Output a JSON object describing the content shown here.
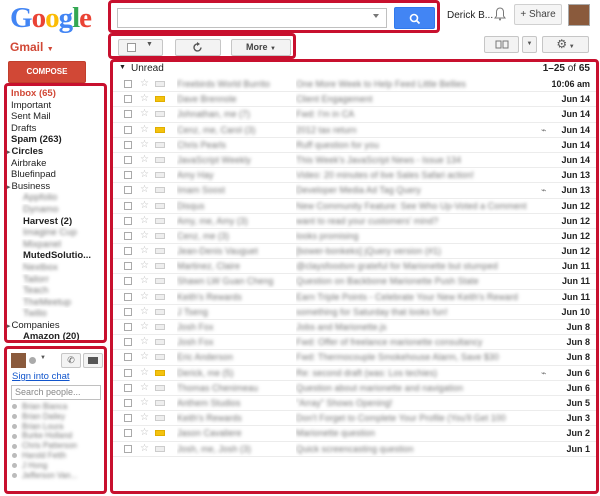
{
  "header": {
    "logo_letters": [
      {
        "ch": "G",
        "color": "#4285f4"
      },
      {
        "ch": "o",
        "color": "#ea4335"
      },
      {
        "ch": "o",
        "color": "#fbbc05"
      },
      {
        "ch": "g",
        "color": "#4285f4"
      },
      {
        "ch": "l",
        "color": "#34a853"
      },
      {
        "ch": "e",
        "color": "#ea4335"
      }
    ],
    "user_name": "Derick B...",
    "share_label": "Share",
    "share_plus": "+"
  },
  "app": {
    "title": "Gmail"
  },
  "toolbar": {
    "more_label": "More"
  },
  "compose_label": "COMPOSE",
  "sidebar": {
    "items": [
      {
        "label": "Inbox (65)",
        "bold": true,
        "red": true,
        "blur": false,
        "indent": 0
      },
      {
        "label": "Important",
        "bold": false,
        "red": false,
        "blur": false,
        "indent": 0
      },
      {
        "label": "Sent Mail",
        "bold": false,
        "red": false,
        "blur": false,
        "indent": 0
      },
      {
        "label": "Drafts",
        "bold": false,
        "red": false,
        "blur": false,
        "indent": 0
      },
      {
        "label": "Spam (263)",
        "bold": true,
        "red": false,
        "blur": false,
        "indent": 0
      },
      {
        "label": "Circles",
        "bold": true,
        "red": false,
        "blur": false,
        "indent": 0,
        "arrow": true
      },
      {
        "label": "Airbrake",
        "bold": false,
        "red": false,
        "blur": false,
        "indent": 0
      },
      {
        "label": "Bluefinpad",
        "bold": false,
        "red": false,
        "blur": false,
        "indent": 0
      },
      {
        "label": "Business",
        "bold": false,
        "red": false,
        "blur": false,
        "indent": 0,
        "arrow": true
      },
      {
        "label": "Appfolio",
        "bold": false,
        "red": false,
        "blur": true,
        "indent": 12
      },
      {
        "label": "Dynamo",
        "bold": false,
        "red": false,
        "blur": true,
        "indent": 12
      },
      {
        "label": "Harvest (2)",
        "bold": true,
        "red": false,
        "blur": false,
        "indent": 12
      },
      {
        "label": "Imagine Cup",
        "bold": false,
        "red": false,
        "blur": true,
        "indent": 12
      },
      {
        "label": "Mixpanel",
        "bold": false,
        "red": false,
        "blur": true,
        "indent": 12
      },
      {
        "label": "MutedSolutio...",
        "bold": true,
        "red": false,
        "blur": false,
        "indent": 12
      },
      {
        "label": "Nextbox",
        "bold": false,
        "red": false,
        "blur": true,
        "indent": 12
      },
      {
        "label": "Tailorr",
        "bold": false,
        "red": false,
        "blur": true,
        "indent": 12
      },
      {
        "label": "Teach",
        "bold": false,
        "red": false,
        "blur": true,
        "indent": 12
      },
      {
        "label": "TheMeetup",
        "bold": false,
        "red": false,
        "blur": true,
        "indent": 12
      },
      {
        "label": "Twilio",
        "bold": false,
        "red": false,
        "blur": true,
        "indent": 12
      },
      {
        "label": "Companies",
        "bold": false,
        "red": false,
        "blur": false,
        "indent": 0,
        "arrow": true
      },
      {
        "label": "Amazon (20)",
        "bold": true,
        "red": false,
        "blur": false,
        "indent": 12
      }
    ]
  },
  "chat": {
    "sign_in_label": "Sign into chat",
    "search_placeholder": "Search people...",
    "contacts": [
      "Brian Bianca",
      "Brian Dailey",
      "Brian Loura",
      "Burke Holland",
      "Chris Patterson",
      "Harold Fetth",
      "J Hong",
      "Jefferson Van..."
    ]
  },
  "mail": {
    "section_label": "Unread",
    "range": "1–25",
    "of_label": "of",
    "total": "65",
    "rows": [
      {
        "sender": "Freebirds World Burrito",
        "subject": "One More Week to Help Feed Little Bellies",
        "date": "10:06 am",
        "flag": "none",
        "clip": false
      },
      {
        "sender": "Dave Brennole",
        "subject": "Client Engagement",
        "date": "Jun 14",
        "flag": "yellow",
        "clip": false
      },
      {
        "sender": "Johnathan, me (7)",
        "subject": "Fwd: I'm in CA",
        "date": "Jun 14",
        "flag": "none",
        "clip": false
      },
      {
        "sender": "Cenz, me, Carol (3)",
        "subject": "2012 tax return",
        "date": "Jun 14",
        "flag": "yellow",
        "clip": true
      },
      {
        "sender": "Chris Pearls",
        "subject": "Ruff question for you",
        "date": "Jun 14",
        "flag": "none",
        "clip": false
      },
      {
        "sender": "JavaScript Weekly",
        "subject": "This Week's JavaScript News - Issue 134",
        "date": "Jun 14",
        "flag": "none",
        "clip": false
      },
      {
        "sender": "Amy Hay",
        "subject": "Video: 20 minutes of live Sales Safari action!",
        "date": "Jun 13",
        "flag": "none",
        "clip": false
      },
      {
        "sender": "Imam Soost",
        "subject": "Developer Media Ad Tag Query",
        "date": "Jun 13",
        "flag": "none",
        "clip": true
      },
      {
        "sender": "Disqus",
        "subject": "New Community Feature: See Who Up-Voted a Comment",
        "date": "Jun 12",
        "flag": "none",
        "clip": false
      },
      {
        "sender": "Amy, me, Amy (3)",
        "subject": "want to read your customers' mind?",
        "date": "Jun 12",
        "flag": "none",
        "clip": false
      },
      {
        "sender": "Cenz, me (3)",
        "subject": "looks promising",
        "date": "Jun 12",
        "flag": "none",
        "clip": false
      },
      {
        "sender": "Jean-Denis Vauguet",
        "subject": "[bower-bonkeks] jQuery version (#1)",
        "date": "Jun 12",
        "flag": "none",
        "clip": false
      },
      {
        "sender": "Martinez, Claire",
        "subject": "@claysfoodsm grateful for Marionette but stumped",
        "date": "Jun 11",
        "flag": "none",
        "clip": false
      },
      {
        "sender": "Shawn LW Guan Cheng",
        "subject": "Question on Backbone Marionette Push State",
        "date": "Jun 11",
        "flag": "none",
        "clip": false
      },
      {
        "sender": "Keith's Rewards",
        "subject": "Earn Triple Points - Celebrate Your New Keith's Reward",
        "date": "Jun 11",
        "flag": "none",
        "clip": false
      },
      {
        "sender": "J Tseng",
        "subject": "something for Saturday that looks fun!",
        "date": "Jun 10",
        "flag": "none",
        "clip": false
      },
      {
        "sender": "Josh Fox",
        "subject": "Jobs and Marionette.js",
        "date": "Jun 8",
        "flag": "none",
        "clip": false
      },
      {
        "sender": "Josh Fox",
        "subject": "Fwd: Offer of freelance marionette consultancy",
        "date": "Jun 8",
        "flag": "none",
        "clip": false
      },
      {
        "sender": "Eric Anderson",
        "subject": "Fwd: Thermocouple Smokehouse Alarm, Save $30",
        "date": "Jun 8",
        "flag": "none",
        "clip": false
      },
      {
        "sender": "Derick, me (5)",
        "subject": "Re: second draft (was: Los techies)",
        "date": "Jun 6",
        "flag": "yellow",
        "clip": true
      },
      {
        "sender": "Thomas Chenimeau",
        "subject": "Question about marionette and navigation",
        "date": "Jun 6",
        "flag": "none",
        "clip": false
      },
      {
        "sender": "Anthem Studios",
        "subject": "\"Array\" Shows Opening!",
        "date": "Jun 5",
        "flag": "none",
        "clip": false
      },
      {
        "sender": "Keith's Rewards",
        "subject": "Don't Forget to Complete Your Profile (You'll Get 100",
        "date": "Jun 3",
        "flag": "none",
        "clip": false
      },
      {
        "sender": "Jason Cavaliere",
        "subject": "Marionette question",
        "date": "Jun 2",
        "flag": "yellow",
        "clip": false
      },
      {
        "sender": "Josh, me, Josh (3)",
        "subject": "Quick screencasting question",
        "date": "Jun 1",
        "flag": "none",
        "clip": false
      }
    ]
  }
}
